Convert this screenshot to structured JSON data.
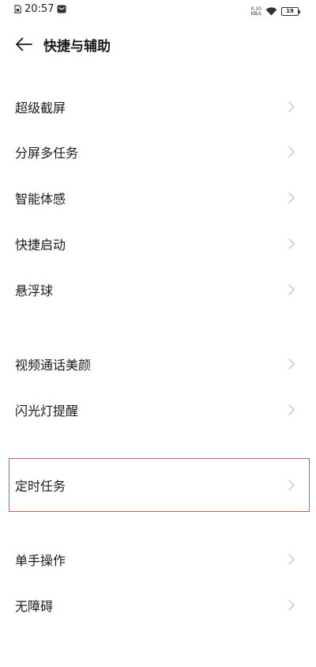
{
  "status_bar": {
    "time": "20:57",
    "net_speed_value": "0.10",
    "net_speed_unit": "KB/s",
    "battery_level": "19"
  },
  "header": {
    "title": "快捷与辅助"
  },
  "items": [
    {
      "label": "超级截屏"
    },
    {
      "label": "分屏多任务"
    },
    {
      "label": "智能体感"
    },
    {
      "label": "快捷启动"
    },
    {
      "label": "悬浮球"
    },
    {
      "label": "视频通话美颜"
    },
    {
      "label": "闪光灯提醒"
    },
    {
      "label": "定时任务"
    },
    {
      "label": "单手操作"
    },
    {
      "label": "无障碍"
    }
  ],
  "colors": {
    "highlight": "#d9534f",
    "chevron": "#c2c2c2",
    "text": "#1a1a1a"
  }
}
